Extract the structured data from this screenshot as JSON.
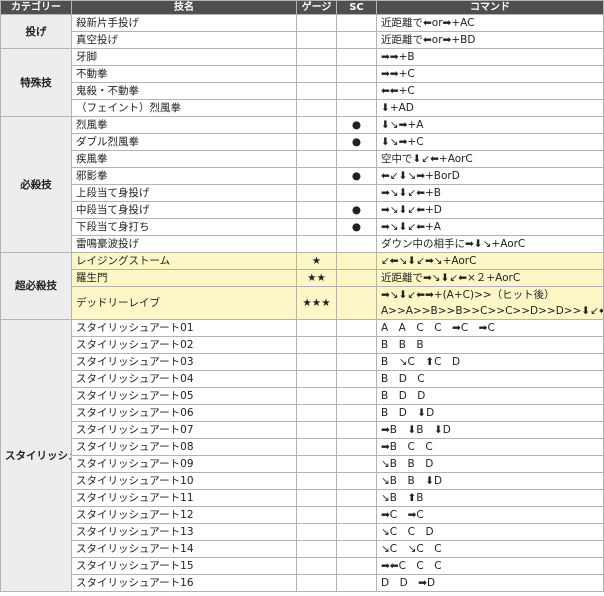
{
  "header": {
    "category": "カテゴリー",
    "move": "技名",
    "gauge": "ゲージ",
    "sc": "SC",
    "command": "コマンド"
  },
  "groups": [
    {
      "category": "投げ",
      "rows": [
        {
          "name": "殺新片手投げ",
          "gauge": "",
          "sc": "",
          "command": "近距離で⬅or➡+AC"
        },
        {
          "name": "真空投げ",
          "gauge": "",
          "sc": "",
          "command": "近距離で⬅or➡+BD"
        }
      ]
    },
    {
      "category": "特殊技",
      "rows": [
        {
          "name": "牙脚",
          "gauge": "",
          "sc": "",
          "command": "➡➡+B"
        },
        {
          "name": "不動拳",
          "gauge": "",
          "sc": "",
          "command": "➡➡+C"
        },
        {
          "name": "鬼殺・不動拳",
          "gauge": "",
          "sc": "",
          "command": "⬅⬅+C"
        },
        {
          "name": "（フェイント）烈風拳",
          "gauge": "",
          "sc": "",
          "command": "⬇+AD"
        }
      ]
    },
    {
      "category": "必殺技",
      "rows": [
        {
          "name": "烈風拳",
          "gauge": "",
          "sc": "●",
          "command": "⬇↘➡+A"
        },
        {
          "name": "ダブル烈風拳",
          "gauge": "",
          "sc": "●",
          "command": "⬇↘➡+C"
        },
        {
          "name": "疾風拳",
          "gauge": "",
          "sc": "",
          "command": "空中で⬇↙⬅+AorC"
        },
        {
          "name": "邪影拳",
          "gauge": "",
          "sc": "●",
          "command": "⬅↙⬇↘➡+BorD"
        },
        {
          "name": "上段当て身投げ",
          "gauge": "",
          "sc": "",
          "command": "➡↘⬇↙⬅+B"
        },
        {
          "name": "中段当て身投げ",
          "gauge": "",
          "sc": "●",
          "command": "➡↘⬇↙⬅+D"
        },
        {
          "name": "下段当て身打ち",
          "gauge": "",
          "sc": "●",
          "command": "➡↘⬇↙⬅+A"
        },
        {
          "name": "雷鳴豪波投げ",
          "gauge": "",
          "sc": "",
          "command": "ダウン中の相手に➡⬇↘+AorC"
        }
      ]
    },
    {
      "category": "超必殺技",
      "rows": [
        {
          "name": "レイジングストーム",
          "gauge": "★",
          "sc": "",
          "command": "↙⬅↘⬇↙➡↘+AorC"
        },
        {
          "name": "羅生門",
          "gauge": "★★",
          "sc": "",
          "command": "近距離で➡↘⬇↙⬅×２+AorC"
        },
        {
          "name": "デッドリーレイブ",
          "gauge": "★★★",
          "sc": "",
          "command": "➡↘⬇↙⬅➡+(A+C)>>（ヒット後）",
          "command2": "A>>A>>B>>B>>C>>C>>D>>D>>⬇↙⬅+C"
        }
      ]
    },
    {
      "category": "スタイリッシュアート",
      "rows": [
        {
          "name": "スタイリッシュアート01",
          "gauge": "",
          "sc": "",
          "command": "A　A　C　C　➡C　➡C"
        },
        {
          "name": "スタイリッシュアート02",
          "gauge": "",
          "sc": "",
          "command": "B　B　B"
        },
        {
          "name": "スタイリッシュアート03",
          "gauge": "",
          "sc": "",
          "command": "B　↘C　⬆C　D"
        },
        {
          "name": "スタイリッシュアート04",
          "gauge": "",
          "sc": "",
          "command": "B　D　C"
        },
        {
          "name": "スタイリッシュアート05",
          "gauge": "",
          "sc": "",
          "command": "B　D　D"
        },
        {
          "name": "スタイリッシュアート06",
          "gauge": "",
          "sc": "",
          "command": "B　D　⬇D"
        },
        {
          "name": "スタイリッシュアート07",
          "gauge": "",
          "sc": "",
          "command": "➡B　⬇B　⬇D"
        },
        {
          "name": "スタイリッシュアート08",
          "gauge": "",
          "sc": "",
          "command": "➡B　C　C"
        },
        {
          "name": "スタイリッシュアート09",
          "gauge": "",
          "sc": "",
          "command": "↘B　B　D"
        },
        {
          "name": "スタイリッシュアート10",
          "gauge": "",
          "sc": "",
          "command": "↘B　B　⬇D"
        },
        {
          "name": "スタイリッシュアート11",
          "gauge": "",
          "sc": "",
          "command": "↘B　⬆B"
        },
        {
          "name": "スタイリッシュアート12",
          "gauge": "",
          "sc": "",
          "command": "➡C　➡C"
        },
        {
          "name": "スタイリッシュアート13",
          "gauge": "",
          "sc": "",
          "command": "↘C　C　D"
        },
        {
          "name": "スタイリッシュアート14",
          "gauge": "",
          "sc": "",
          "command": "↘C　↘C　C"
        },
        {
          "name": "スタイリッシュアート15",
          "gauge": "",
          "sc": "",
          "command": "➡⬅C　C　C"
        },
        {
          "name": "スタイリッシュアート16",
          "gauge": "",
          "sc": "",
          "command": "D　D　➡D"
        }
      ]
    }
  ]
}
